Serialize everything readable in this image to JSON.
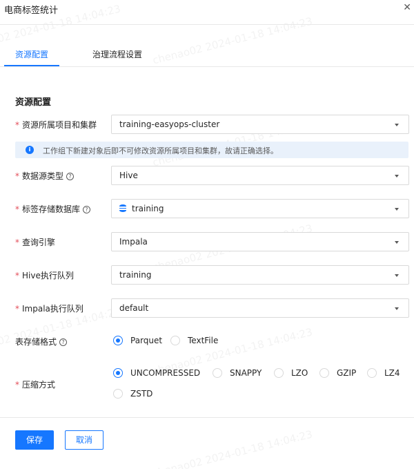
{
  "dialog": {
    "title": "电商标签统计",
    "close_icon": "close-icon"
  },
  "tabs": [
    {
      "label": "资源配置",
      "active": true
    },
    {
      "label": "治理流程设置",
      "active": false
    }
  ],
  "section": {
    "title": "资源配置"
  },
  "fields": {
    "project_cluster": {
      "label": "资源所属项目和集群",
      "required": true,
      "value": "training-easyops-cluster"
    },
    "alert": {
      "icon": "info-icon",
      "text": "工作组下新建对象后即不可修改资源所属项目和集群，故请正确选择。"
    },
    "datasource_type": {
      "label": "数据源类型",
      "required": true,
      "value": "Hive",
      "help_icon": "help-icon"
    },
    "tag_database": {
      "label": "标签存储数据库",
      "required": true,
      "value": "training",
      "icon": "database-icon",
      "help_icon": "help-icon"
    },
    "query_engine": {
      "label": "查询引擎",
      "required": true,
      "value": "Impala"
    },
    "hive_queue": {
      "label": "Hive执行队列",
      "required": true,
      "value": "training"
    },
    "impala_queue": {
      "label": "Impala执行队列",
      "required": true,
      "value": "default"
    },
    "storage_format": {
      "label": "表存储格式",
      "required": false,
      "help_icon": "help-icon",
      "options": [
        "Parquet",
        "TextFile"
      ],
      "selected": "Parquet"
    },
    "compression": {
      "label": "压缩方式",
      "required": true,
      "options": [
        "UNCOMPRESSED",
        "SNAPPY",
        "LZO",
        "GZIP",
        "LZ4",
        "ZSTD"
      ],
      "selected": "UNCOMPRESSED"
    }
  },
  "footer": {
    "save_label": "保存",
    "cancel_label": "取消"
  },
  "watermark": "chenao02 2024-01-18 14:04:23",
  "colors": {
    "accent": "#1677ff",
    "required": "#e34d59",
    "alert_bg": "#e9f1fb"
  }
}
